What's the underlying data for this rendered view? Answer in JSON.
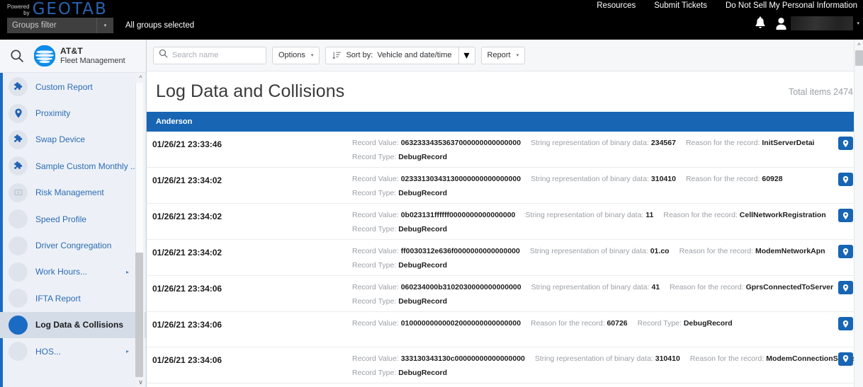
{
  "topbar": {
    "powered_line1": "Powered",
    "powered_line2": "by",
    "logo": "GEOTAB",
    "groups_filter_placeholder": "Groups filter",
    "groups_status": "All groups selected",
    "links": [
      {
        "label": "Resources"
      },
      {
        "label": "Submit Tickets"
      },
      {
        "label": "Do Not Sell My Personal Information"
      }
    ],
    "bell_icon": "notification-bell-icon",
    "user_icon": "person-icon",
    "user_name": "",
    "user_caret": "▾"
  },
  "sidebar": {
    "search_icon": "search-icon",
    "brand_line1": "AT&T",
    "brand_line2": "Fleet Management",
    "items": [
      {
        "label": "Custom Report",
        "icon": "puzzle-icon",
        "icon_style": "puzzle",
        "active": false,
        "submenu": false
      },
      {
        "label": "Proximity",
        "icon": "proximity-icon",
        "icon_style": "proximity",
        "active": false,
        "submenu": false
      },
      {
        "label": "Swap Device",
        "icon": "puzzle-icon",
        "icon_style": "puzzle",
        "active": false,
        "submenu": false
      },
      {
        "label": "Sample Custom Monthly ...",
        "icon": "puzzle-icon",
        "icon_style": "puzzle",
        "active": false,
        "submenu": false
      },
      {
        "label": "Risk Management",
        "icon": "risk-icon",
        "icon_style": "faint",
        "active": false,
        "submenu": false
      },
      {
        "label": "Speed Profile",
        "icon": "blank-icon",
        "icon_style": "blank",
        "active": false,
        "submenu": false
      },
      {
        "label": "Driver Congregation",
        "icon": "blank-icon",
        "icon_style": "blank",
        "active": false,
        "submenu": false
      },
      {
        "label": "Work Hours...",
        "icon": "blank-icon",
        "icon_style": "blank",
        "active": false,
        "submenu": true
      },
      {
        "label": "IFTA Report",
        "icon": "blank-icon",
        "icon_style": "blank",
        "active": false,
        "submenu": false
      },
      {
        "label": "Log Data & Collisions",
        "icon": "solid-dot-icon",
        "icon_style": "solid",
        "active": true,
        "submenu": false
      },
      {
        "label": "HOS...",
        "icon": "blank-icon",
        "icon_style": "blank",
        "active": false,
        "submenu": true
      }
    ],
    "scroll_up_icon": "chevron-up-icon",
    "scroll_down_icon": "chevron-down-icon"
  },
  "toolbar": {
    "search_placeholder": "Search name",
    "search_value": "",
    "search_icon": "search-icon",
    "options_label": "Options",
    "sort_label": "Sort by:",
    "sort_value": "Vehicle and date/time",
    "sort_icon": "sort-ascending-icon",
    "report_label": "Report",
    "caret": "▾"
  },
  "page": {
    "title": "Log Data and Collisions",
    "total_items_label": "Total items 2474",
    "group_header": "Anderson",
    "scroll_up_icon": "chevron-up-icon"
  },
  "labels": {
    "record_value": "Record Value:",
    "string_rep": "String representation of binary data:",
    "reason": "Reason for the record:",
    "record_type": "Record Type:",
    "pin_icon": "map-pin-icon"
  },
  "rows": [
    {
      "datetime": "01/26/21 23:33:46",
      "record_value": "06323334353637000000000000000",
      "string_rep": "234567",
      "reason": "InitServerDetai",
      "record_type": "DebugRecord",
      "two_line": true
    },
    {
      "datetime": "01/26/21 23:34:02",
      "record_value": "02333130343130000000000000000",
      "string_rep": "310410",
      "reason": "60928",
      "record_type": "DebugRecord",
      "two_line": true
    },
    {
      "datetime": "01/26/21 23:34:02",
      "record_value": "0b023131ffffff0000000000000000",
      "string_rep": "11",
      "reason": "CellNetworkRegistration",
      "record_type": "DebugRecord",
      "two_line": true
    },
    {
      "datetime": "01/26/21 23:34:02",
      "record_value": "ff0030312e636f0000000000000000",
      "string_rep": "01.co",
      "reason": "ModemNetworkApn",
      "record_type": "DebugRecord",
      "two_line": true
    },
    {
      "datetime": "01/26/21 23:34:06",
      "record_value": "060234000b3102030000000000000",
      "string_rep": "41",
      "reason": "GprsConnectedToServer",
      "record_type": "DebugRecord",
      "two_line": true
    },
    {
      "datetime": "01/26/21 23:34:06",
      "record_value": "01000000000002000000000000000",
      "string_rep": "",
      "reason": "60726",
      "record_type": "DebugRecord",
      "two_line": false
    },
    {
      "datetime": "01/26/21 23:34:06",
      "record_value": "333130343130c00000000000000000",
      "string_rep": "310410",
      "reason": "ModemConnectionSuccess",
      "record_type": "DebugRecord",
      "two_line": true
    }
  ],
  "colors": {
    "brand_blue": "#1765b3",
    "geotab_blue": "#2b62b0",
    "sidebar_bg": "#edf1f7",
    "link_blue": "#2c6cb5"
  }
}
